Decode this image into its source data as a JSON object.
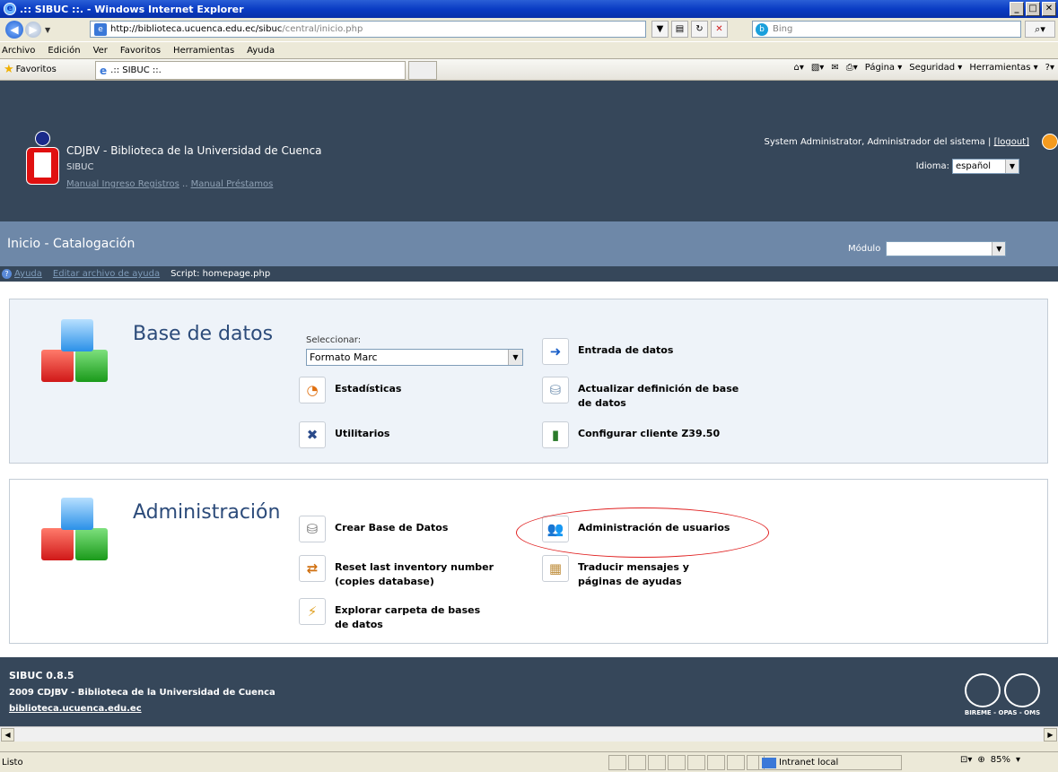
{
  "window": {
    "title": ".:: SIBUC ::. - Windows Internet Explorer"
  },
  "address": {
    "host": "http://biblioteca.ucuenca.edu.ec/sibuc",
    "path": "/central/inicio.php"
  },
  "search": {
    "placeholder": "Bing"
  },
  "menu": [
    "Archivo",
    "Edición",
    "Ver",
    "Favoritos",
    "Herramientas",
    "Ayuda"
  ],
  "favbar": {
    "favorites": "Favoritos",
    "tab": ".:: SIBUC ::.",
    "commands": [
      "Página ▾",
      "Seguridad ▾",
      "Herramientas ▾"
    ]
  },
  "header": {
    "site_name": "CDJBV - Biblioteca de la Universidad de Cuenca",
    "site_sub": "SIBUC",
    "link1": "Manual Ingreso Registros",
    "link_sep": " .. ",
    "link2": "Manual Préstamos",
    "user_text": "System Administrator, Administrador del sistema | ",
    "logout": "[logout]",
    "idioma_label": "Idioma:",
    "idioma_value": "español"
  },
  "section": {
    "title": "Inicio - Catalogación",
    "modulo_label": "Módulo"
  },
  "helpbar": {
    "help": "Ayuda",
    "edit": "Editar archivo de ayuda",
    "script": "Script: homepage.php"
  },
  "db_panel": {
    "title": "Base de datos",
    "select_label": "Seleccionar:",
    "select_value": "Formato Marc",
    "items": [
      "Entrada de datos",
      "Estadísticas",
      "Actualizar definición de base de datos",
      "Utilitarios",
      "Configurar cliente Z39.50"
    ]
  },
  "admin_panel": {
    "title": "Administración",
    "items": [
      "Crear Base de Datos",
      "Administración de usuarios",
      "Reset last inventory number (copies database)",
      "Traducir mensajes y páginas de ayudas",
      "Explorar carpeta de bases de datos"
    ]
  },
  "footer": {
    "version": "SIBUC 0.8.5",
    "copyright": "2009 CDJBV - Biblioteca de la Universidad de Cuenca",
    "url": "biblioteca.ucuenca.edu.ec",
    "logo_text": "BIREME - OPAS - OMS"
  },
  "status": {
    "text": "Listo",
    "zone": "Intranet local",
    "zoom": "85%"
  }
}
